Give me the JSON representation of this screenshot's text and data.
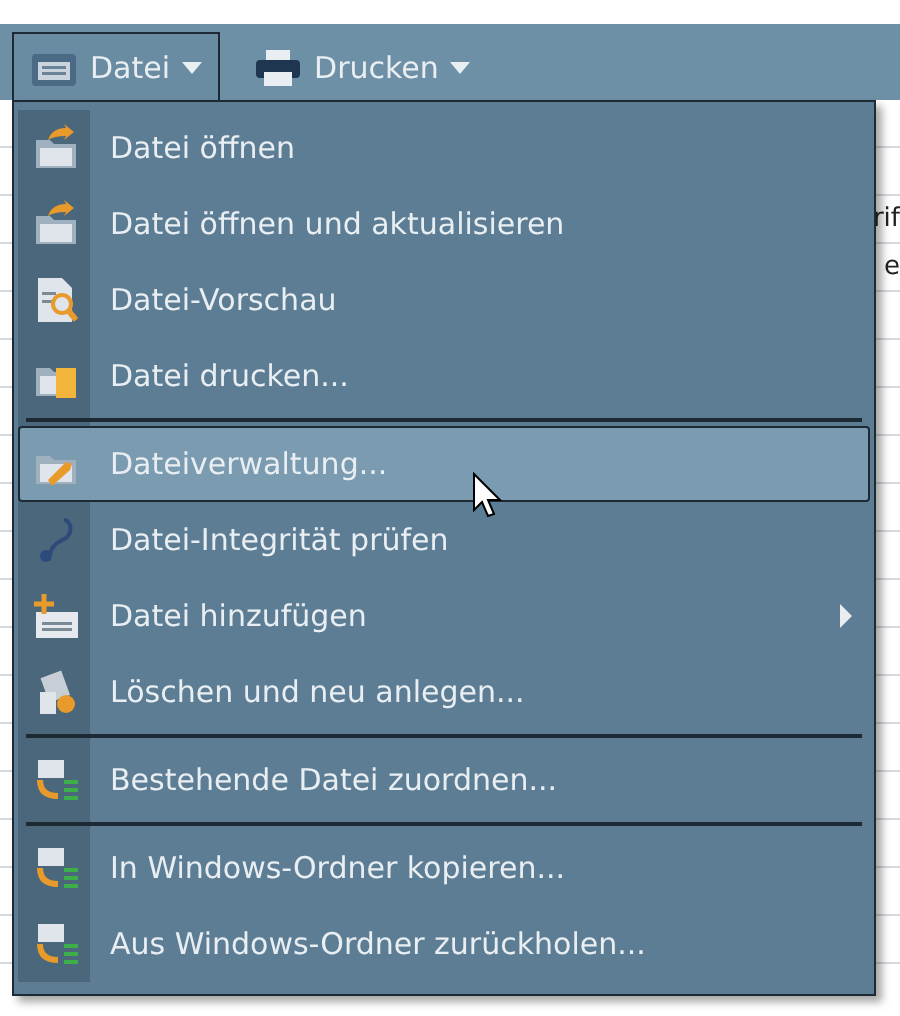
{
  "toolbar": {
    "buttons": [
      {
        "label": "Datei",
        "selected": true
      },
      {
        "label": "Drucken",
        "selected": false
      }
    ]
  },
  "background": {
    "fragments": [
      "rif",
      "e"
    ]
  },
  "menu": {
    "items": [
      {
        "kind": "item",
        "label": "Datei öffnen",
        "selected": false,
        "submenu": false
      },
      {
        "kind": "item",
        "label": "Datei öffnen und aktualisieren",
        "selected": false,
        "submenu": false
      },
      {
        "kind": "item",
        "label": "Datei-Vorschau",
        "selected": false,
        "submenu": false
      },
      {
        "kind": "item",
        "label": "Datei drucken...",
        "selected": false,
        "submenu": false
      },
      {
        "kind": "separator"
      },
      {
        "kind": "item",
        "label": "Dateiverwaltung...",
        "selected": true,
        "submenu": false
      },
      {
        "kind": "item",
        "label": "Datei-Integrität prüfen",
        "selected": false,
        "submenu": false
      },
      {
        "kind": "item",
        "label": "Datei hinzufügen",
        "selected": false,
        "submenu": true
      },
      {
        "kind": "item",
        "label": "Löschen und neu anlegen...",
        "selected": false,
        "submenu": false
      },
      {
        "kind": "separator"
      },
      {
        "kind": "item",
        "label": "Bestehende Datei zuordnen...",
        "selected": false,
        "submenu": false
      },
      {
        "kind": "separator"
      },
      {
        "kind": "item",
        "label": "In Windows-Ordner kopieren...",
        "selected": false,
        "submenu": false
      },
      {
        "kind": "item",
        "label": "Aus Windows-Ordner zurückholen...",
        "selected": false,
        "submenu": false
      }
    ]
  }
}
